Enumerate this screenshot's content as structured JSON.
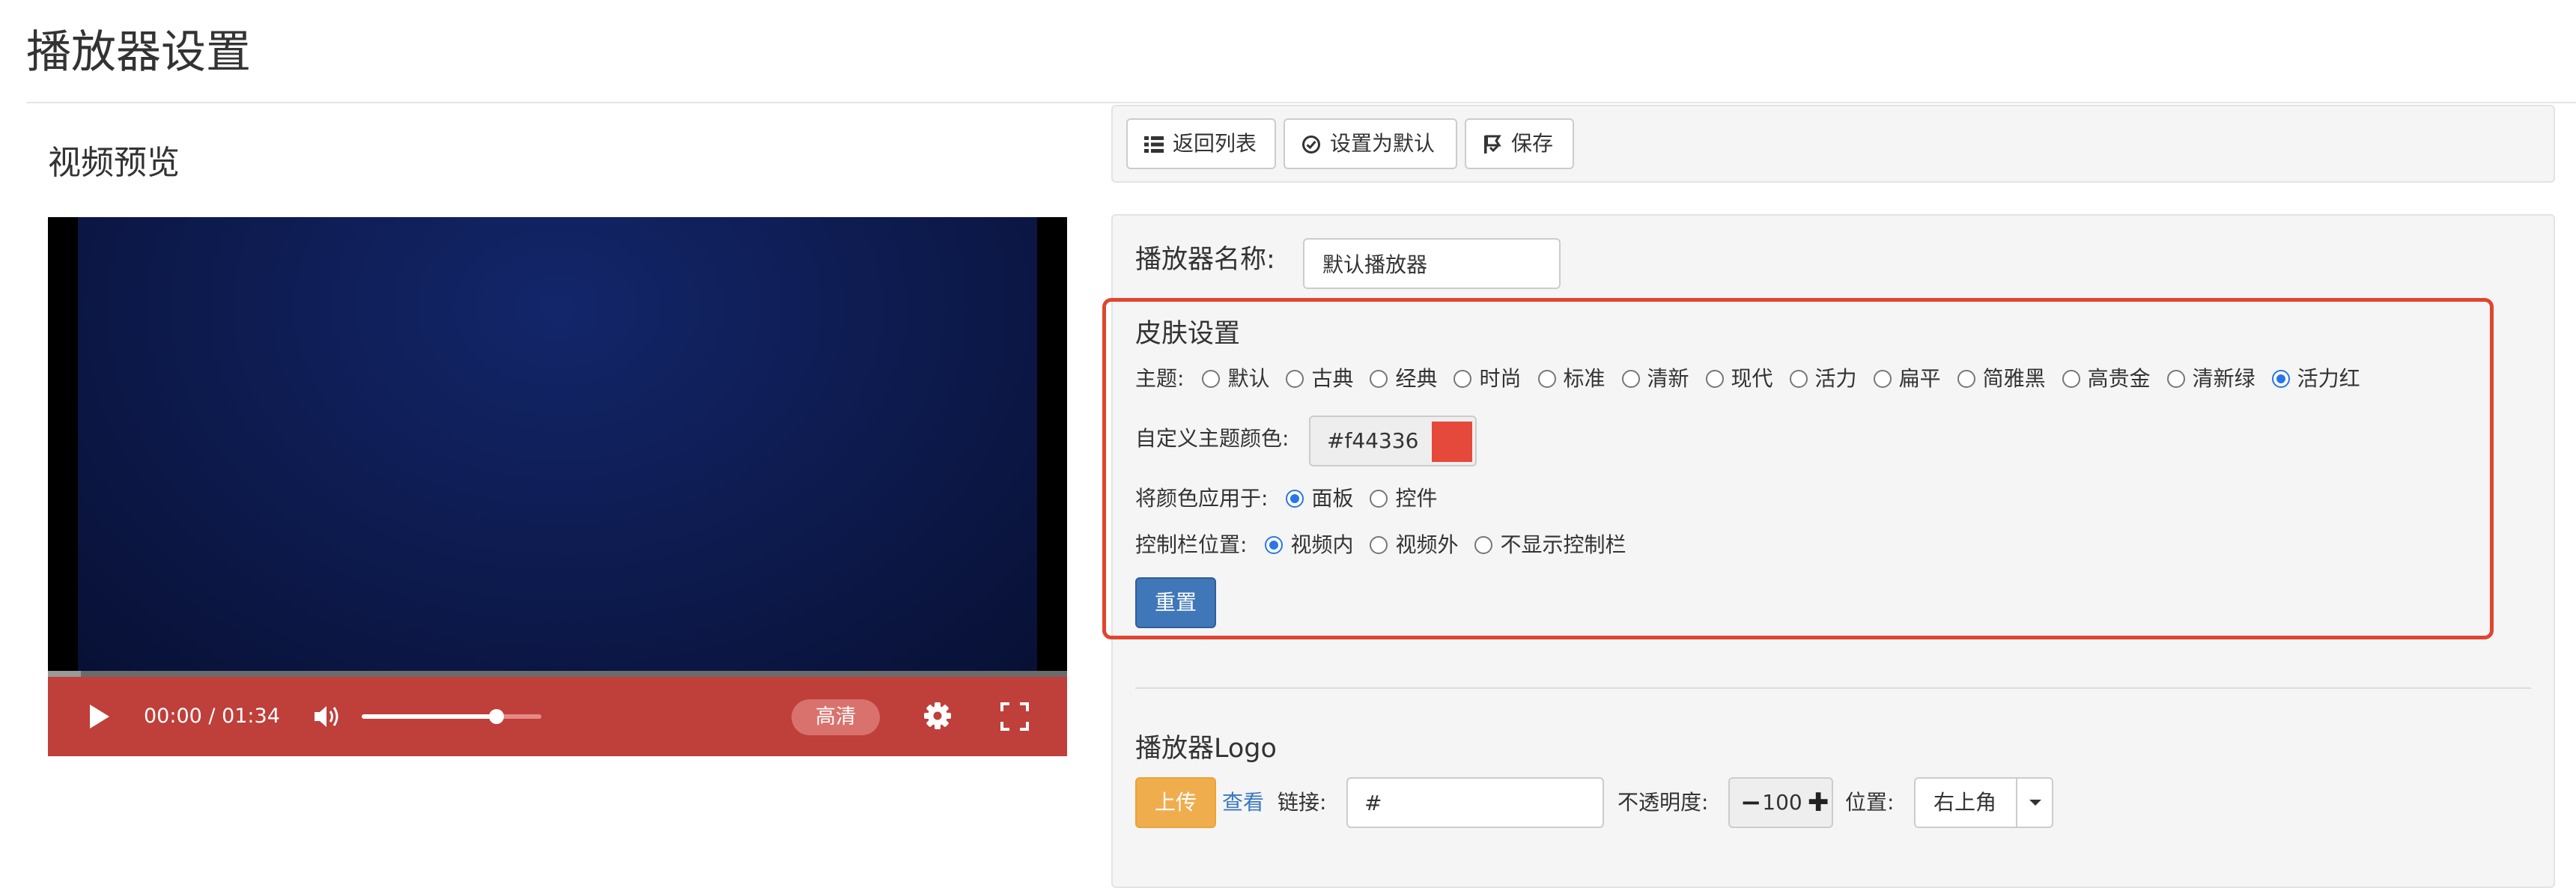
{
  "page": {
    "title": "播放器设置"
  },
  "preview": {
    "title": "视频预览",
    "time": "00:00 / 01:34",
    "volume_level": 0.75,
    "progress": 0,
    "quality_label": "高清",
    "control_bar_color": "#bf3f3a"
  },
  "toolbar": {
    "back_label": "返回列表",
    "default_label": "设置为默认",
    "save_label": "保存"
  },
  "form": {
    "name_label": "播放器名称:",
    "name_value": "默认播放器"
  },
  "skin": {
    "title": "皮肤设置",
    "theme_label": "主题:",
    "themes": [
      {
        "label": "默认",
        "selected": false
      },
      {
        "label": "古典",
        "selected": false
      },
      {
        "label": "经典",
        "selected": false
      },
      {
        "label": "时尚",
        "selected": false
      },
      {
        "label": "标准",
        "selected": false
      },
      {
        "label": "清新",
        "selected": false
      },
      {
        "label": "现代",
        "selected": false
      },
      {
        "label": "活力",
        "selected": false
      },
      {
        "label": "扁平",
        "selected": false
      },
      {
        "label": "简雅黑",
        "selected": false
      },
      {
        "label": "高贵金",
        "selected": false
      },
      {
        "label": "清新绿",
        "selected": false
      },
      {
        "label": "活力红",
        "selected": true
      }
    ],
    "color_label": "自定义主题颜色:",
    "color_value": "#f44336",
    "swatch_color": "#e4493b",
    "apply_label": "将颜色应用于:",
    "apply_options": [
      {
        "label": "面板",
        "selected": true
      },
      {
        "label": "控件",
        "selected": false
      }
    ],
    "ctrl_label": "控制栏位置:",
    "ctrl_options": [
      {
        "label": "视频内",
        "selected": true
      },
      {
        "label": "视频外",
        "selected": false
      },
      {
        "label": "不显示控制栏",
        "selected": false
      }
    ],
    "reset_label": "重置"
  },
  "logo": {
    "title": "播放器Logo",
    "upload_label": "上传",
    "view_label": "查看",
    "link_label": "链接:",
    "link_value": "#",
    "opacity_label": "不透明度:",
    "opacity_value": "100",
    "position_label": "位置:",
    "position_value": "右上角"
  }
}
